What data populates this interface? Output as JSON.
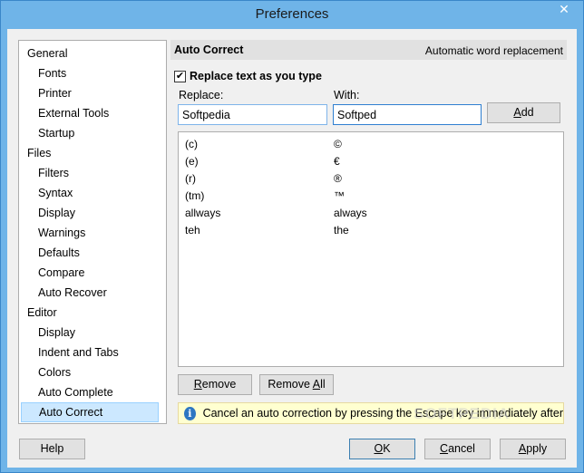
{
  "window": {
    "title": "Preferences",
    "close_glyph": "✕"
  },
  "sidebar": {
    "items": [
      {
        "label": "General",
        "level": "group"
      },
      {
        "label": "Fonts",
        "level": "child"
      },
      {
        "label": "Printer",
        "level": "child"
      },
      {
        "label": "External Tools",
        "level": "child"
      },
      {
        "label": "Startup",
        "level": "child"
      },
      {
        "label": "Files",
        "level": "group"
      },
      {
        "label": "Filters",
        "level": "child"
      },
      {
        "label": "Syntax",
        "level": "child"
      },
      {
        "label": "Display",
        "level": "child"
      },
      {
        "label": "Warnings",
        "level": "child"
      },
      {
        "label": "Defaults",
        "level": "child"
      },
      {
        "label": "Compare",
        "level": "child"
      },
      {
        "label": "Auto Recover",
        "level": "child"
      },
      {
        "label": "Editor",
        "level": "group"
      },
      {
        "label": "Display",
        "level": "child"
      },
      {
        "label": "Indent and Tabs",
        "level": "child"
      },
      {
        "label": "Colors",
        "level": "child"
      },
      {
        "label": "Auto Complete",
        "level": "child"
      },
      {
        "label": "Auto Correct",
        "level": "child",
        "selected": true
      }
    ]
  },
  "panel": {
    "title": "Auto Correct",
    "subtitle": "Automatic word replacement",
    "checkbox_label": "Replace text as you type",
    "checkbox_checked": true,
    "checkbox_glyph": "✔",
    "replace_label": "Replace:",
    "with_label": "With:",
    "replace_value": "Softpedia",
    "with_value": "Softped",
    "add_button": {
      "mnemonic": "A",
      "rest": "dd"
    },
    "remove_button": {
      "mnemonic": "R",
      "rest": "emove"
    },
    "remove_all_button": {
      "prefix": "Remove ",
      "mnemonic": "A",
      "rest": "ll"
    },
    "table": [
      {
        "replace": "(c)",
        "with": "©"
      },
      {
        "replace": "(e)",
        "with": "€"
      },
      {
        "replace": "(r)",
        "with": "®"
      },
      {
        "replace": "(tm)",
        "with": "™"
      },
      {
        "replace": "allways",
        "with": "always"
      },
      {
        "replace": "teh",
        "with": "the"
      }
    ],
    "info_text": "Cancel an auto correction by pressing the Escape key immediately after",
    "info_icon": "i",
    "watermark": "SOFTPEDIA"
  },
  "footer": {
    "help_label": "Help",
    "ok_button": {
      "mnemonic": "O",
      "rest": "K"
    },
    "cancel_button": {
      "mnemonic": "C",
      "rest": "ancel"
    },
    "apply_button": {
      "mnemonic": "A",
      "rest": "pply"
    }
  }
}
